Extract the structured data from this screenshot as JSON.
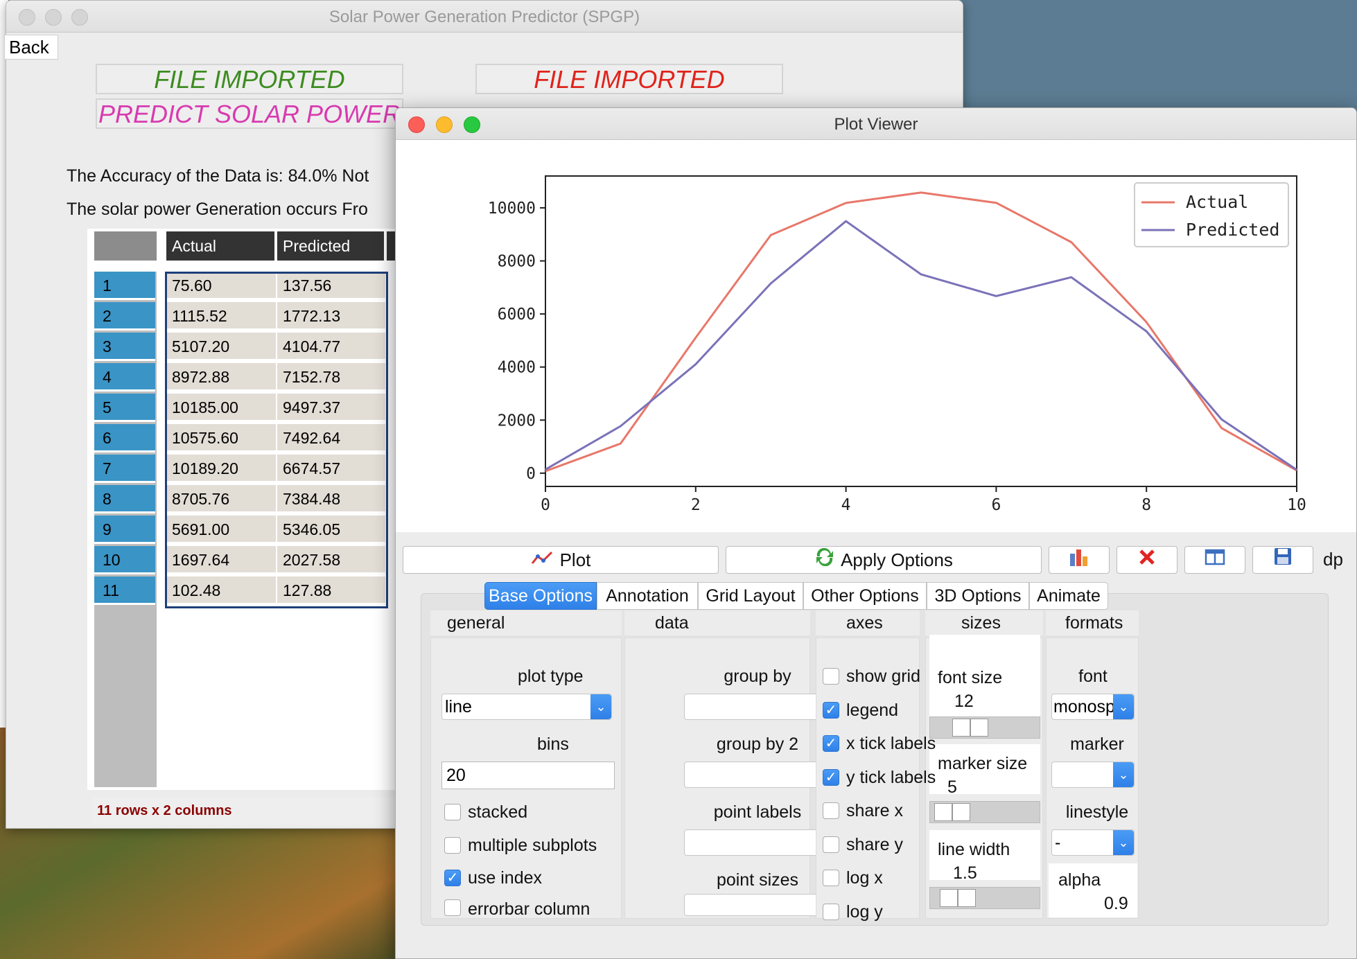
{
  "colors": {
    "actual_line": "#e8776a",
    "predicted_line": "#7a72b8",
    "file_imported_green": "#3c8c1f",
    "file_imported_red": "#e0231b",
    "predict_magenta": "#d83ab0",
    "accent": "#2f80e8",
    "status_text": "#8b0000"
  },
  "main_window": {
    "title": "Solar Power Generation Predictor (SPGP)",
    "back_label": "Back",
    "banner_left": "FILE IMPORTED",
    "banner_right": "FILE IMPORTED",
    "banner_predict": "PREDICT SOLAR POWER",
    "accuracy_text": "The Accuracy of the Data is: 84.0% Not",
    "generation_text": "The solar power Generation occurs Fro",
    "table": {
      "columns": [
        "Actual",
        "Predicted"
      ],
      "rows": [
        {
          "num": "1",
          "actual": "75.60",
          "predicted": "137.56"
        },
        {
          "num": "2",
          "actual": "1115.52",
          "predicted": "1772.13"
        },
        {
          "num": "3",
          "actual": "5107.20",
          "predicted": "4104.77"
        },
        {
          "num": "4",
          "actual": "8972.88",
          "predicted": "7152.78"
        },
        {
          "num": "5",
          "actual": "10185.00",
          "predicted": "9497.37"
        },
        {
          "num": "6",
          "actual": "10575.60",
          "predicted": "7492.64"
        },
        {
          "num": "7",
          "actual": "10189.20",
          "predicted": "6674.57"
        },
        {
          "num": "8",
          "actual": "8705.76",
          "predicted": "7384.48"
        },
        {
          "num": "9",
          "actual": "5691.00",
          "predicted": "5346.05"
        },
        {
          "num": "10",
          "actual": "1697.64",
          "predicted": "2027.58"
        },
        {
          "num": "11",
          "actual": "102.48",
          "predicted": "127.88"
        }
      ]
    },
    "status": "11  rows x  2  columns"
  },
  "plot_viewer": {
    "title": "Plot Viewer",
    "toolbar": {
      "plot_label": "Plot",
      "apply_label": "Apply Options",
      "dp_label": "dp"
    },
    "tabs": [
      "Base Options",
      "Annotation",
      "Grid Layout",
      "Other Options",
      "3D Options",
      "Animate"
    ],
    "sections": {
      "general": "general",
      "data": "data",
      "axes": "axes",
      "sizes": "sizes",
      "formats": "formats"
    },
    "general": {
      "plot_type_label": "plot type",
      "plot_type_value": "line",
      "bins_label": "bins",
      "bins_value": "20",
      "stacked_label": "stacked",
      "multiple_subplots_label": "multiple subplots",
      "use_index_label": "use index",
      "errorbar_label": "errorbar column"
    },
    "data": {
      "group_by_label": "group by",
      "group_by_2_label": "group by 2",
      "point_labels_label": "point labels",
      "point_sizes_label": "point sizes"
    },
    "axes": [
      {
        "label": "show grid",
        "checked": false
      },
      {
        "label": "legend",
        "checked": true
      },
      {
        "label": "x tick labels",
        "checked": true
      },
      {
        "label": "y tick labels",
        "checked": true
      },
      {
        "label": "share x",
        "checked": false
      },
      {
        "label": "share y",
        "checked": false
      },
      {
        "label": "log x",
        "checked": false
      },
      {
        "label": "log y",
        "checked": false
      }
    ],
    "sizes": {
      "font_size_label": "font size",
      "font_size_value": "12",
      "marker_size_label": "marker size",
      "marker_size_value": "5",
      "line_width_label": "line width",
      "line_width_value": "1.5"
    },
    "formats": {
      "font_label": "font",
      "font_value": "monosp",
      "marker_label": "marker",
      "marker_value": "",
      "linestyle_label": "linestyle",
      "linestyle_value": "-",
      "alpha_label": "alpha",
      "alpha_value": "0.9"
    }
  },
  "chart_data": {
    "type": "line",
    "x": [
      0,
      1,
      2,
      3,
      4,
      5,
      6,
      7,
      8,
      9,
      10
    ],
    "series": [
      {
        "name": "Actual",
        "values": [
          75.6,
          1115.52,
          5107.2,
          8972.88,
          10185.0,
          10575.6,
          10189.2,
          8705.76,
          5691.0,
          1697.64,
          102.48
        ]
      },
      {
        "name": "Predicted",
        "values": [
          137.56,
          1772.13,
          4104.77,
          7152.78,
          9497.37,
          7492.64,
          6674.57,
          7384.48,
          5346.05,
          2027.58,
          127.88
        ]
      }
    ],
    "xticks": [
      0,
      2,
      4,
      6,
      8,
      10
    ],
    "yticks": [
      0,
      2000,
      4000,
      6000,
      8000,
      10000
    ],
    "xlim": [
      0,
      10
    ],
    "ylim": [
      -500,
      11200
    ],
    "grid": false,
    "legend_position": "top-right"
  }
}
